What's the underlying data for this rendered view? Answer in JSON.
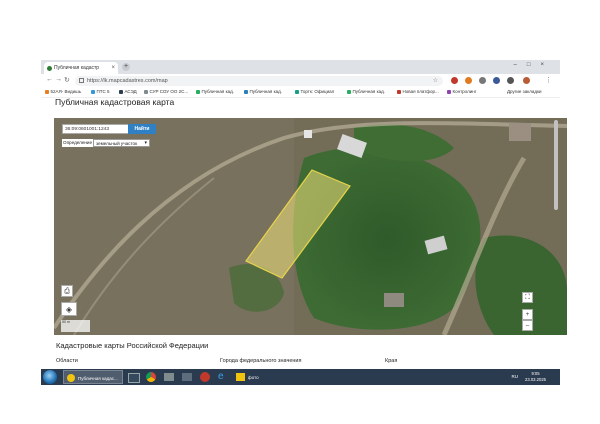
{
  "browser": {
    "tab_title": "Публичная кадастр",
    "url": "https://lk.mapcad.ru/map",
    "url_domain": "https://lk.mapcadastres.com/map",
    "bookmarks": [
      "52АЯ- Видишь",
      "ПТС 5",
      "АСЭД",
      "СУР СОУ ОО 2С...",
      "Публичная кад.",
      "Публичная кад.",
      "Тортк: Официал",
      "Публичная кад.",
      "Новая платфор...",
      "Контролинг"
    ],
    "other_bookmarks": "Другие закладки"
  },
  "page": {
    "title": "Публичная кадастровая карта",
    "search_value": "36:09:0601001:1243",
    "find_label": "Найти",
    "define_label": "Определение",
    "define_value": "земельный участок",
    "scale_text": "50 m",
    "section_title": "Кадастровые карты Российской Федерации",
    "columns": [
      "Области",
      "Города федерального значения",
      "Края"
    ]
  },
  "taskbar": {
    "apps": [
      "Публичная кадас...",
      "",
      "",
      "",
      "",
      "",
      "фото"
    ],
    "lang": "RU",
    "time": "9:05",
    "date": "23.03.2025"
  },
  "colors": {
    "parcel_fill": "#f2e27a",
    "parcel_stroke": "#e8d34a",
    "find_button": "#2f80c4",
    "taskbar": "#2a3a4f"
  }
}
